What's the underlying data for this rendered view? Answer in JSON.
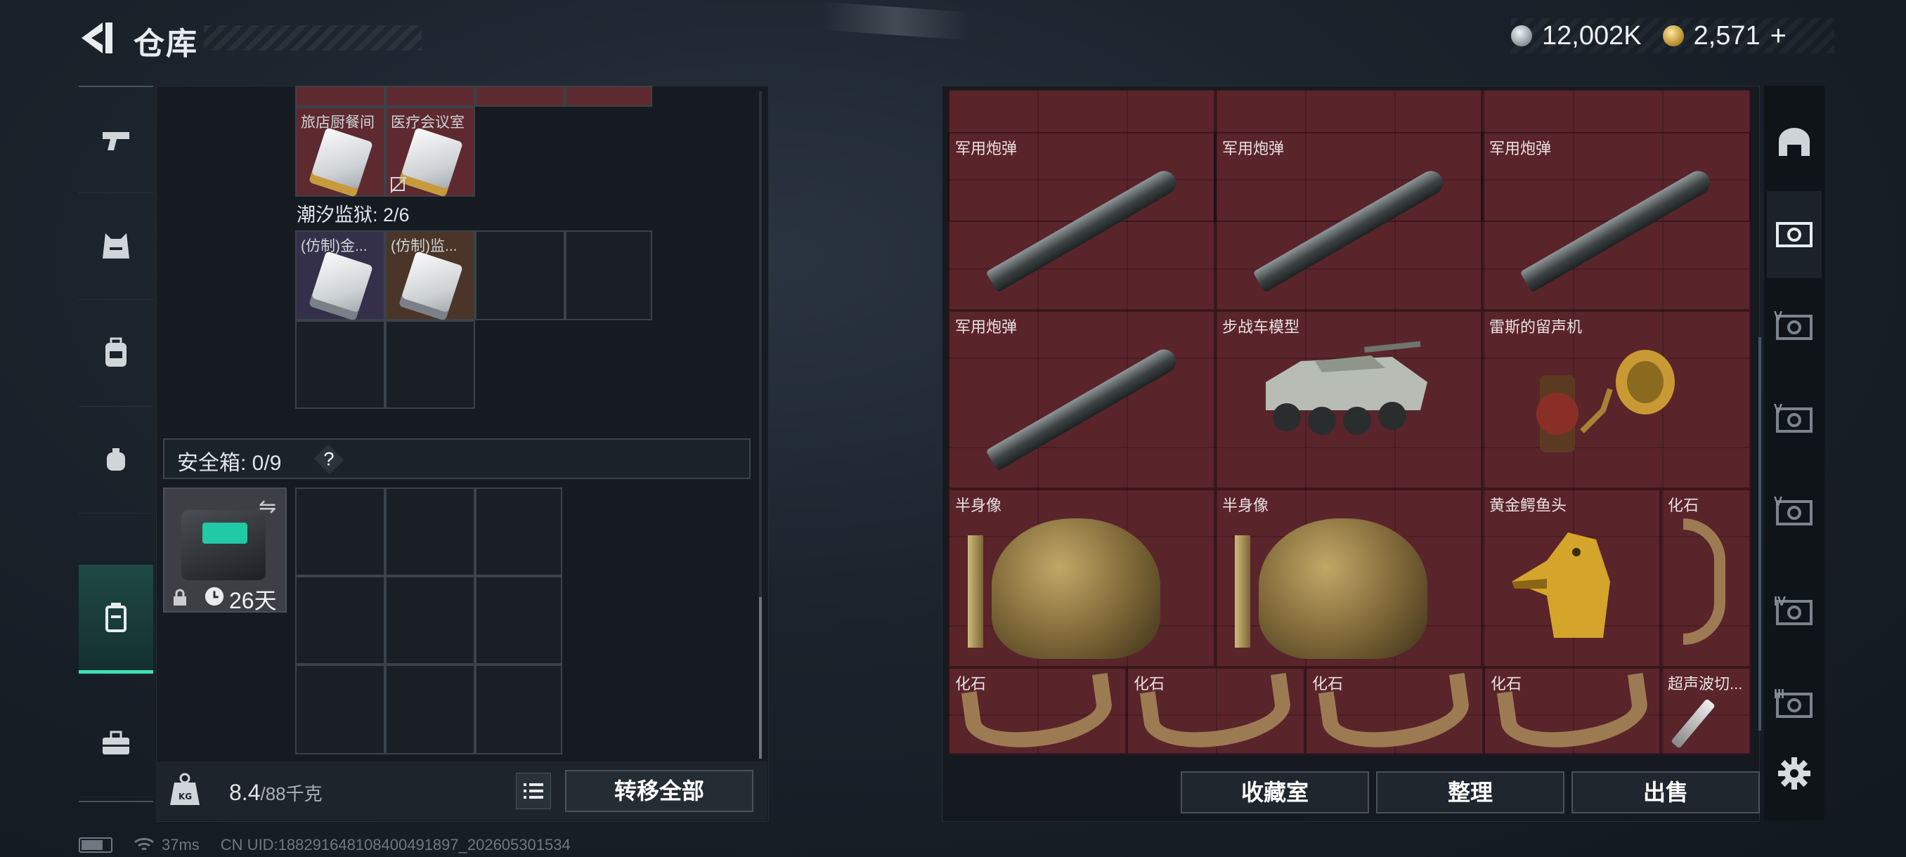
{
  "header": {
    "title": "仓库",
    "currency": {
      "silver_value": "12,002K",
      "gold_value": "2,571",
      "plus_label": "+"
    }
  },
  "left_nav": {
    "items": [
      {
        "name": "weapon",
        "icon": "pistol-icon",
        "active": false
      },
      {
        "name": "armor",
        "icon": "vest-icon",
        "active": false
      },
      {
        "name": "backpack",
        "icon": "backpack-icon",
        "active": false
      },
      {
        "name": "pouch",
        "icon": "pouch-icon",
        "active": false
      },
      {
        "name": "keycase",
        "icon": "keycase-icon",
        "active": true
      },
      {
        "name": "toolbox",
        "icon": "toolbox-icon",
        "active": false
      }
    ]
  },
  "keycards": {
    "top_row": [
      {
        "label": "旅店厨餐间",
        "tint": "red"
      },
      {
        "label": "医疗会议室",
        "tint": "red"
      }
    ],
    "prison_section": "潮汐监狱: 2/6",
    "prison_row": [
      {
        "label": "(仿制)金...",
        "tint": "purple"
      },
      {
        "label": "(仿制)监...",
        "tint": "brown"
      }
    ]
  },
  "safe_box": {
    "label": "安全箱: 0/9",
    "help": "?",
    "timer": "26天"
  },
  "weight": {
    "current": "8.4",
    "max": "/88千克"
  },
  "buttons": {
    "transfer_all": "转移全部",
    "collection_room": "收藏室",
    "organize": "整理",
    "sell": "出售"
  },
  "stash_items": [
    {
      "name": "军用炮弹",
      "type": "shell"
    },
    {
      "name": "军用炮弹",
      "type": "shell"
    },
    {
      "name": "军用炮弹",
      "type": "shell"
    },
    {
      "name": "军用炮弹",
      "type": "shell"
    },
    {
      "name": "步战车模型",
      "type": "tank"
    },
    {
      "name": "雷斯的留声机",
      "type": "gramophone"
    },
    {
      "name": "半身像",
      "type": "bust"
    },
    {
      "name": "半身像",
      "type": "bust"
    },
    {
      "name": "黄金鳄鱼头",
      "type": "croc"
    },
    {
      "name": "化石",
      "type": "claw"
    },
    {
      "name": "化石",
      "type": "fossil"
    },
    {
      "name": "化石",
      "type": "fossil"
    },
    {
      "name": "化石",
      "type": "fossil"
    },
    {
      "name": "化石",
      "type": "fossil"
    },
    {
      "name": "超声波切...",
      "type": "knife"
    }
  ],
  "right_tabs": [
    {
      "icon": "arch-icon",
      "label": ""
    },
    {
      "icon": "stash-tab-icon",
      "label": ""
    },
    {
      "icon": "stash-tab-icon",
      "label": "V"
    },
    {
      "icon": "stash-tab-icon",
      "label": "V"
    },
    {
      "icon": "stash-tab-icon",
      "label": "V"
    },
    {
      "icon": "stash-tab-icon",
      "label": "IV"
    },
    {
      "icon": "stash-tab-icon",
      "label": "III"
    }
  ],
  "status_bar": {
    "ping": "37ms",
    "uid": "CN UID:188291648108400491897_202605301534"
  }
}
